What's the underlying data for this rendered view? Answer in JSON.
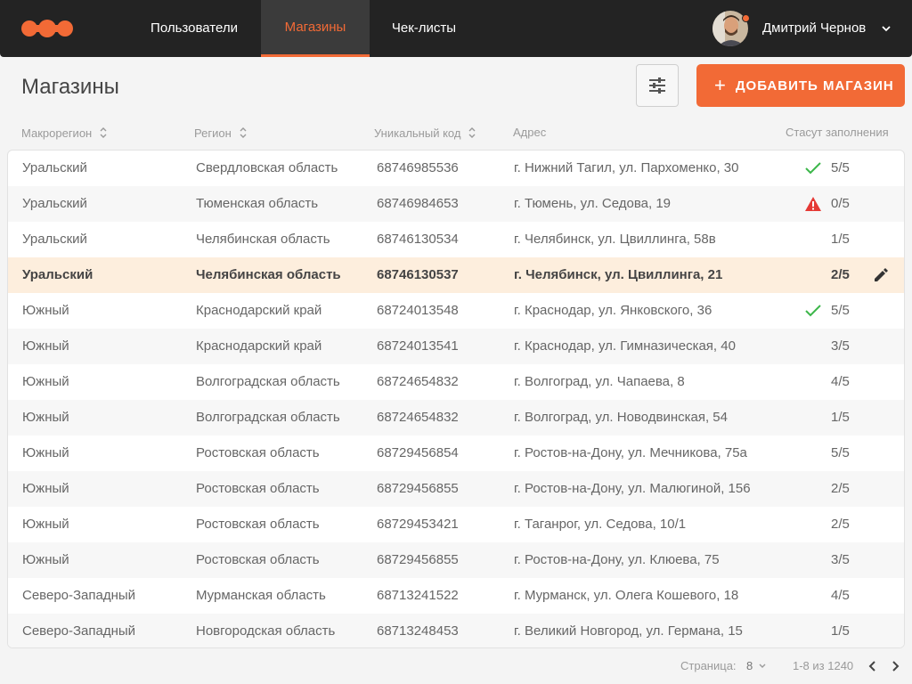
{
  "header": {
    "nav": [
      {
        "label": "Пользователи",
        "active": false
      },
      {
        "label": "Магазины",
        "active": true
      },
      {
        "label": "Чек-листы",
        "active": false
      }
    ],
    "user_name": "Дмитрий Чернов",
    "accent": "#f26a36"
  },
  "page": {
    "title": "Магазины",
    "add_button": "ДОБАВИТЬ МАГАЗИН"
  },
  "table": {
    "columns": [
      "Макрорегион",
      "Регион",
      "Уникальный код",
      "Адрес",
      "Стасут заполнения"
    ],
    "rows": [
      {
        "macro": "Уральский",
        "region": "Свердловская область",
        "code": "68746985536",
        "address": "г. Нижний Тагил, ул. Пархоменко, 30",
        "status": "5/5",
        "icon": "check-icon"
      },
      {
        "macro": "Уральский",
        "region": "Тюменская область",
        "code": "68746984653",
        "address": "г. Тюмень, ул. Седова, 19",
        "status": "0/5",
        "icon": "warning-icon"
      },
      {
        "macro": "Уральский",
        "region": "Челябинская область",
        "code": "68746130534",
        "address": "г. Челябинск, ул. Цвиллинга, 58в",
        "status": "1/5",
        "icon": ""
      },
      {
        "macro": "Уральский",
        "region": "Челябинская область",
        "code": "68746130537",
        "address": "г. Челябинск, ул. Цвиллинга, 21",
        "status": "2/5",
        "icon": "",
        "selected": true
      },
      {
        "macro": "Южный",
        "region": "Краснодарский край",
        "code": "68724013548",
        "address": "г. Краснодар, ул. Янковского, 36",
        "status": "5/5",
        "icon": "check-icon"
      },
      {
        "macro": "Южный",
        "region": "Краснодарский край",
        "code": "68724013541",
        "address": "г. Краснодар, ул. Гимназическая, 40",
        "status": "3/5",
        "icon": ""
      },
      {
        "macro": "Южный",
        "region": "Волгоградская область",
        "code": "68724654832",
        "address": "г. Волгоград, ул. Чапаева, 8",
        "status": "4/5",
        "icon": ""
      },
      {
        "macro": "Южный",
        "region": "Волгоградская область",
        "code": "68724654832",
        "address": "г. Волгоград, ул. Новодвинская, 54",
        "status": "1/5",
        "icon": ""
      },
      {
        "macro": "Южный",
        "region": "Ростовская область",
        "code": "68729456854",
        "address": "г. Ростов-на-Дону, ул. Мечникова, 75а",
        "status": "5/5",
        "icon": ""
      },
      {
        "macro": "Южный",
        "region": "Ростовская область",
        "code": "68729456855",
        "address": "г. Ростов-на-Дону, ул. Малюгиной, 156",
        "status": "2/5",
        "icon": ""
      },
      {
        "macro": "Южный",
        "region": "Ростовская область",
        "code": "68729453421",
        "address": "г. Таганрог, ул. Седова, 10/1",
        "status": "2/5",
        "icon": ""
      },
      {
        "macro": "Южный",
        "region": "Ростовская область",
        "code": "68729456855",
        "address": "г. Ростов-на-Дону, ул. Клюева, 75",
        "status": "3/5",
        "icon": ""
      },
      {
        "macro": "Северо-Западный",
        "region": "Мурманская область",
        "code": "68713241522",
        "address": "г. Мурманск, ул. Олега Кошевого, 18",
        "status": "4/5",
        "icon": ""
      },
      {
        "macro": "Северо-Западный",
        "region": "Новгородская область",
        "code": "68713248453",
        "address": "г. Великий Новгород, ул. Германа, 15",
        "status": "1/5",
        "icon": ""
      }
    ]
  },
  "pagination": {
    "label": "Страница:",
    "per_page": "8",
    "range": "1-8 из 1240"
  }
}
